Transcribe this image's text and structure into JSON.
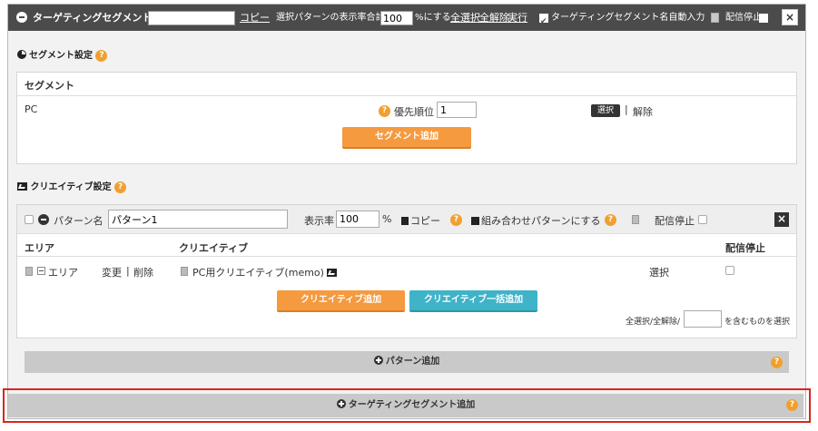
{
  "header": {
    "title": "ターゲティングセグメント名",
    "name_value": "",
    "copy_link": "コピー",
    "total_label_pre": "選択パターンの表示率合計を",
    "total_value": "100",
    "total_label_post": "%にする",
    "select_all": "全選択",
    "deselect_all": "全解除",
    "execute": "実行",
    "auto_input_label": "ターゲティングセグメント名自動入力",
    "auto_input_checked": true,
    "stop_label": "配信停止",
    "close": "×"
  },
  "segment_settings": {
    "title": "セグメント設定",
    "help": "?",
    "box_title": "セグメント",
    "row": {
      "name": "PC",
      "priority_label": "優先順位",
      "priority_value": "1",
      "select_button": "選択",
      "separator": "|",
      "remove_link": "解除"
    },
    "add_button": "セグメント追加"
  },
  "creative_settings": {
    "title": "クリエイティブ設定",
    "help": "?",
    "pattern": {
      "name_label": "パターン名",
      "name_value": "パターン1",
      "rate_label": "表示率",
      "rate_value": "100",
      "rate_unit": "%",
      "copy": "コピー",
      "combine": "組み合わせパターンにする",
      "stop_label": "配信停止",
      "close": "×"
    },
    "table": {
      "headers": [
        "エリア",
        "クリエイティブ",
        "配信停止"
      ],
      "row": {
        "area": "エリア",
        "change": "変更",
        "separator": "|",
        "remove": "削除",
        "creative": "PC用クリエイティブ(memo)",
        "select": "選択"
      }
    },
    "add_creative": "クリエイティブ追加",
    "bulk_add_creative": "クリエイティブ一括追加",
    "filter_pre": "全選択/全解除/",
    "filter_value": "",
    "filter_post": "を含むものを選択"
  },
  "add_pattern": "パターン追加",
  "add_segment": "ターゲティングセグメント追加",
  "colors": {
    "header_bg": "#4b4b4b",
    "orange": "#f59a3f",
    "teal": "#3fb3c8",
    "highlight": "#d9261c"
  }
}
